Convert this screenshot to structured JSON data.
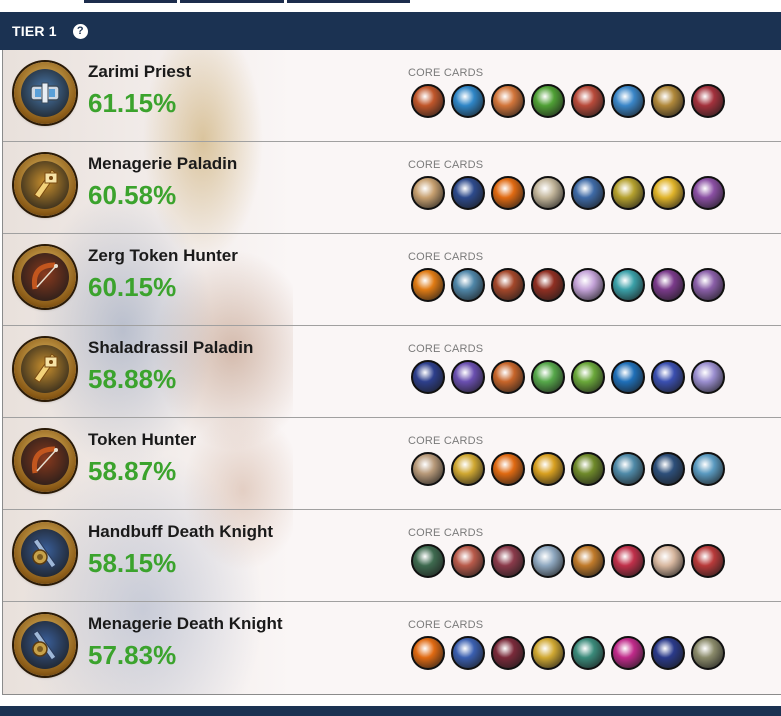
{
  "tier": {
    "title": "TIER 1",
    "help_glyph": "?"
  },
  "core_cards_label": "CORE CARDS",
  "decks": [
    {
      "name": "Zarimi Priest",
      "winrate": "61.15%",
      "class_icon": "priest-icon",
      "class_color": "#4a7bb0",
      "cards": [
        {
          "icon": "dragon-card-icon",
          "color": "#c0562a"
        },
        {
          "icon": "murloc-card-icon",
          "color": "#2f86c7"
        },
        {
          "icon": "bird-card-icon",
          "color": "#d2753a"
        },
        {
          "icon": "green-dragon-card-icon",
          "color": "#4fa035"
        },
        {
          "icon": "creature-card-icon",
          "color": "#b84a3a"
        },
        {
          "icon": "blue-creature-card-icon",
          "color": "#3a86c8"
        },
        {
          "icon": "wyrm-card-icon",
          "color": "#b0883a"
        },
        {
          "icon": "red-dragon-card-icon",
          "color": "#a3313c"
        }
      ]
    },
    {
      "name": "Menagerie Paladin",
      "winrate": "60.58%",
      "class_icon": "paladin-icon",
      "class_color": "#c9902e",
      "cards": [
        {
          "icon": "robot-card-icon",
          "color": "#c7a070"
        },
        {
          "icon": "mech-card-icon",
          "color": "#2d4a8c"
        },
        {
          "icon": "pumpkin-card-icon",
          "color": "#e06a12"
        },
        {
          "icon": "eagle-card-icon",
          "color": "#c2b59a"
        },
        {
          "icon": "warrior-card-icon",
          "color": "#3e6aa6"
        },
        {
          "icon": "golden-card-icon",
          "color": "#b5a12e"
        },
        {
          "icon": "gold-helm-card-icon",
          "color": "#e0b42a"
        },
        {
          "icon": "purple-paladin-card-icon",
          "color": "#8a4fa3"
        }
      ]
    },
    {
      "name": "Zerg Token Hunter",
      "winrate": "60.15%",
      "class_icon": "hunter-icon",
      "class_color": "#8a3a1e",
      "cards": [
        {
          "icon": "orange-orb-card-icon",
          "color": "#e07b14"
        },
        {
          "icon": "hydralisk-card-icon",
          "color": "#4f86a8"
        },
        {
          "icon": "zerg-card-icon",
          "color": "#a3472a"
        },
        {
          "icon": "red-zerg-card-icon",
          "color": "#8f2f22"
        },
        {
          "icon": "spell-card-icon",
          "color": "#c4a3d8"
        },
        {
          "icon": "beast-card-icon",
          "color": "#3aa0a8"
        },
        {
          "icon": "brood-card-icon",
          "color": "#7a3a8a"
        },
        {
          "icon": "purple-beast-card-icon",
          "color": "#8a5fa8"
        }
      ]
    },
    {
      "name": "Shaladrassil Paladin",
      "winrate": "58.88%",
      "class_icon": "paladin-icon",
      "class_color": "#c9902e",
      "cards": [
        {
          "icon": "elf-card-icon",
          "color": "#2d3f8c"
        },
        {
          "icon": "unicorn-card-icon",
          "color": "#6a4fb0"
        },
        {
          "icon": "orc-card-icon",
          "color": "#c7652a"
        },
        {
          "icon": "frog-card-icon",
          "color": "#56a84a"
        },
        {
          "icon": "demon-card-icon",
          "color": "#6aa83a"
        },
        {
          "icon": "crystal-card-icon",
          "color": "#1f6fb8"
        },
        {
          "icon": "spirit-card-icon",
          "color": "#3a4fb0"
        },
        {
          "icon": "violet-card-icon",
          "color": "#9b8fd0"
        }
      ]
    },
    {
      "name": "Token Hunter",
      "winrate": "58.87%",
      "class_icon": "hunter-icon",
      "class_color": "#8a3a1e",
      "cards": [
        {
          "icon": "owl-card-icon",
          "color": "#b89a7a"
        },
        {
          "icon": "moth-card-icon",
          "color": "#d0a832"
        },
        {
          "icon": "pumpkin-card-icon",
          "color": "#e06a12"
        },
        {
          "icon": "bee-card-icon",
          "color": "#d8a020"
        },
        {
          "icon": "vine-card-icon",
          "color": "#6f8a2a"
        },
        {
          "icon": "ghost-card-icon",
          "color": "#4f8aa8"
        },
        {
          "icon": "night-card-icon",
          "color": "#2d4f7a"
        },
        {
          "icon": "gnome-card-icon",
          "color": "#5a9ac0"
        }
      ]
    },
    {
      "name": "Handbuff Death Knight",
      "winrate": "58.15%",
      "class_icon": "death-knight-icon",
      "class_color": "#3a5f9a",
      "cards": [
        {
          "icon": "goblin-card-icon",
          "color": "#3e6a4f"
        },
        {
          "icon": "undead-card-icon",
          "color": "#b85a4a"
        },
        {
          "icon": "ghoul-card-icon",
          "color": "#8a3a4a"
        },
        {
          "icon": "wolf-card-icon",
          "color": "#8fa8c0"
        },
        {
          "icon": "barrel-card-icon",
          "color": "#c07a2a"
        },
        {
          "icon": "imp-card-icon",
          "color": "#c0304a"
        },
        {
          "icon": "pale-card-icon",
          "color": "#d8b8a0"
        },
        {
          "icon": "fiend-card-icon",
          "color": "#b83a3a"
        }
      ]
    },
    {
      "name": "Menagerie Death Knight",
      "winrate": "57.83%",
      "class_icon": "death-knight-icon",
      "class_color": "#3a5f9a",
      "cards": [
        {
          "icon": "pumpkin-card-icon",
          "color": "#e06a12"
        },
        {
          "icon": "shark-card-icon",
          "color": "#3a5fb0"
        },
        {
          "icon": "bone-card-icon",
          "color": "#7a2a3a"
        },
        {
          "icon": "moth-card-icon",
          "color": "#d0a832"
        },
        {
          "icon": "dragonkin-card-icon",
          "color": "#3a8a7a"
        },
        {
          "icon": "magenta-card-icon",
          "color": "#c02a8a"
        },
        {
          "icon": "shadow-card-icon",
          "color": "#2a3a8a"
        },
        {
          "icon": "lich-card-icon",
          "color": "#8a8a6a"
        }
      ]
    }
  ]
}
